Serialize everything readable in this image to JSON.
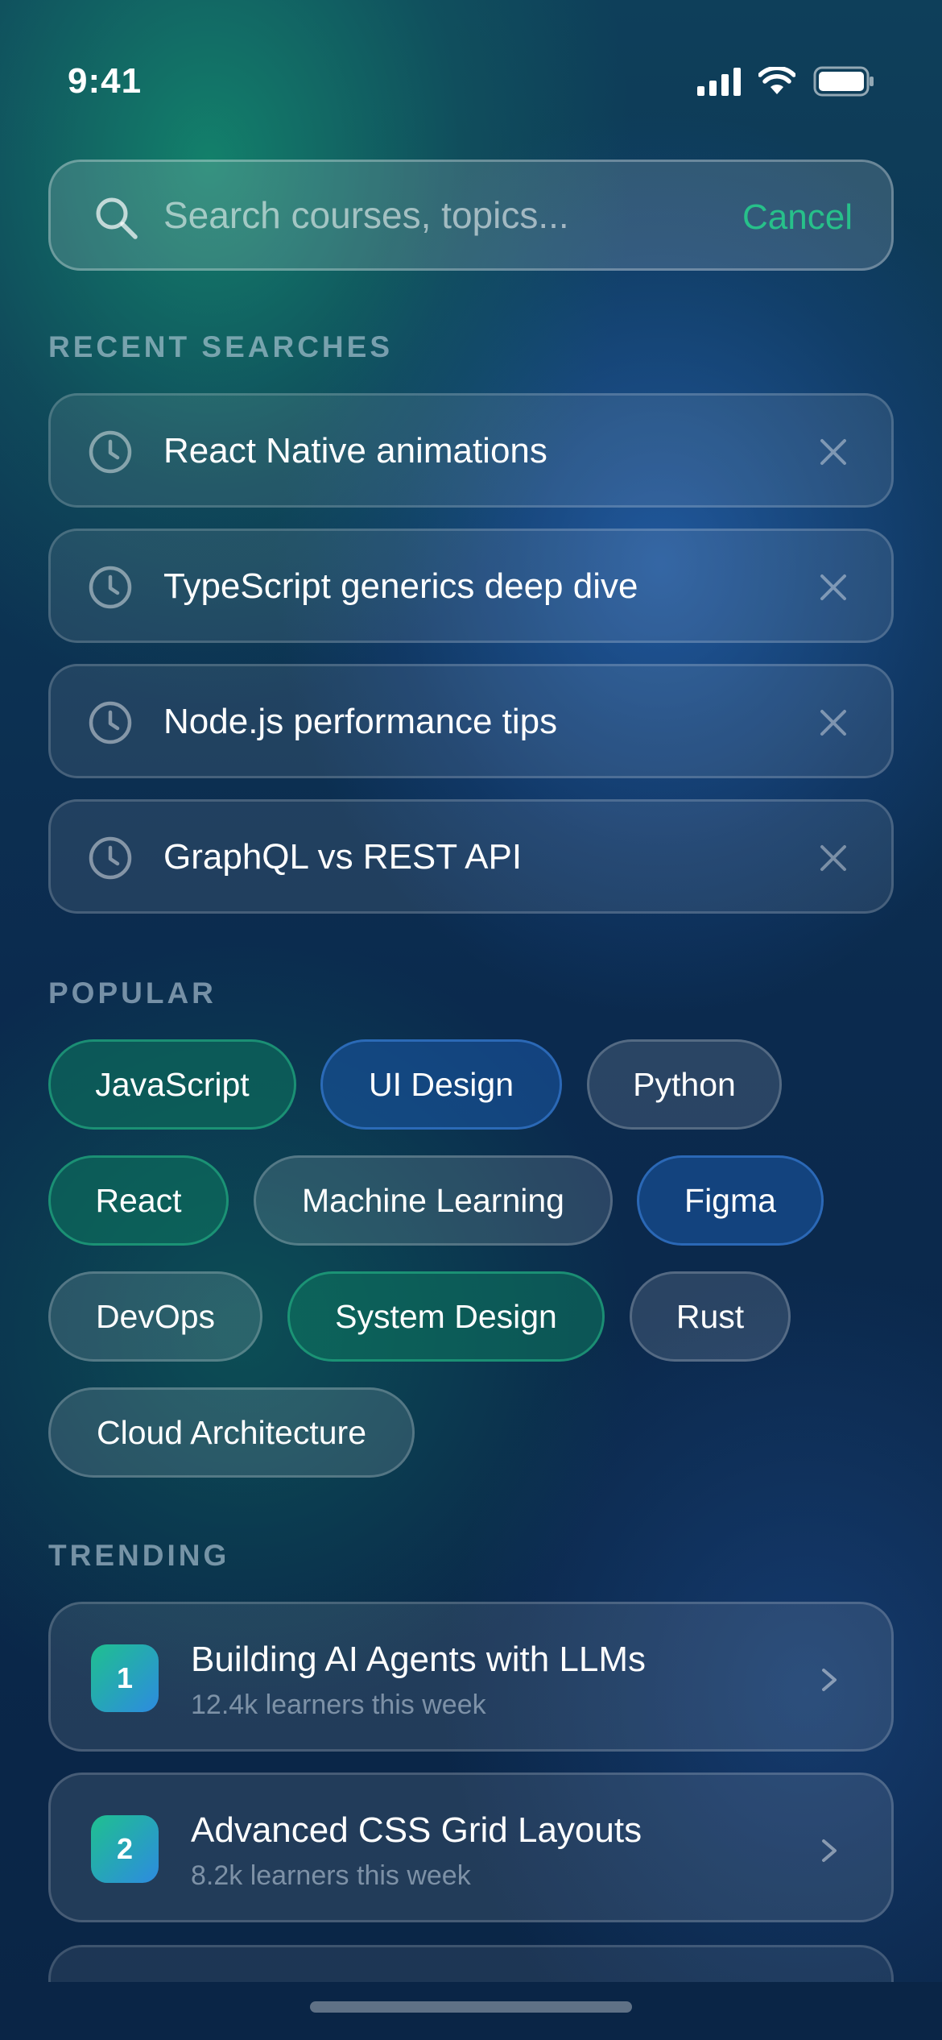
{
  "status_bar": {
    "time": "9:41"
  },
  "search": {
    "placeholder": "Search courses, topics...",
    "cancel_label": "Cancel"
  },
  "recent": {
    "title": "RECENT SEARCHES",
    "items": [
      {
        "label": "React Native animations"
      },
      {
        "label": "TypeScript generics deep dive"
      },
      {
        "label": "Node.js performance tips"
      },
      {
        "label": "GraphQL vs REST API"
      }
    ]
  },
  "popular": {
    "title": "POPULAR",
    "chips": [
      {
        "label": "JavaScript",
        "style": "green"
      },
      {
        "label": "UI Design",
        "style": "blue"
      },
      {
        "label": "Python",
        "style": "neutral"
      },
      {
        "label": "React",
        "style": "green"
      },
      {
        "label": "Machine Learning",
        "style": "neutral"
      },
      {
        "label": "Figma",
        "style": "blue"
      },
      {
        "label": "DevOps",
        "style": "neutral"
      },
      {
        "label": "System Design",
        "style": "green"
      },
      {
        "label": "Rust",
        "style": "neutral"
      },
      {
        "label": "Cloud Architecture",
        "style": "neutral"
      }
    ]
  },
  "trending": {
    "title": "TRENDING",
    "items": [
      {
        "rank": "1",
        "title": "Building AI Agents with LLMs",
        "subtitle": "12.4k learners this week"
      },
      {
        "rank": "2",
        "title": "Advanced CSS Grid Layouts",
        "subtitle": "8.2k learners this week"
      }
    ]
  },
  "colors": {
    "accent": "#27c08a",
    "chip_blue": "#1955a0",
    "chip_green": "#0e785f"
  }
}
